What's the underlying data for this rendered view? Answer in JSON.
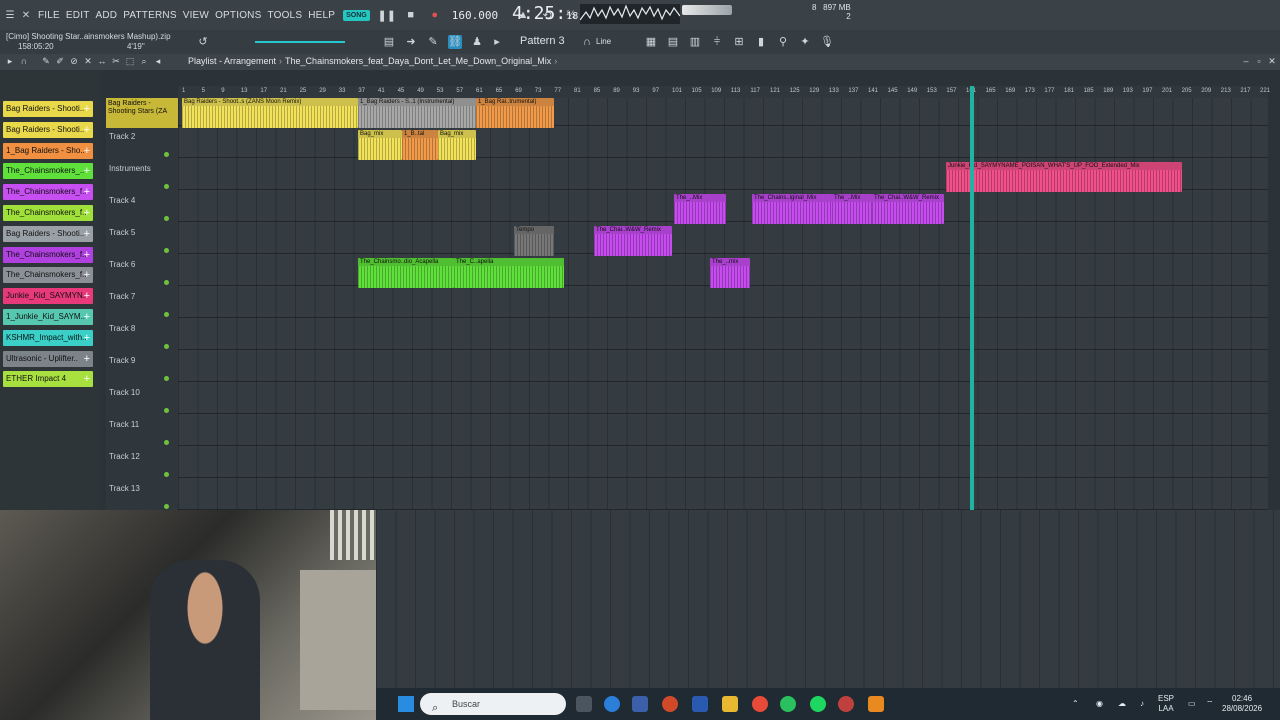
{
  "menu": [
    "FILE",
    "EDIT",
    "ADD",
    "PATTERNS",
    "VIEW",
    "OPTIONS",
    "TOOLS",
    "HELP"
  ],
  "transport": {
    "song_label": "SONG",
    "tempo": "160.000",
    "clock": "4:25",
    "clock_sub": "18",
    "memory": "897 MB",
    "mem_line2": "2",
    "cpu_num": "8"
  },
  "project": {
    "name": "[Cimo] Shooting Star..ainsmokers Mashup).zip",
    "time": "158:05:20",
    "length": "4'19\""
  },
  "toolbar2": {
    "pattern": "Pattern 3",
    "snap": "Line"
  },
  "playlist": {
    "title": "Playlist - Arrangement",
    "clip_name": "The_Chainsmokers_feat_Daya_Dont_Let_Me_Down_Original_Mix"
  },
  "picker": [
    {
      "label": "Bag Raiders - Shooti..",
      "color": "#e8d84a"
    },
    {
      "label": "Bag Raiders - Shooti..",
      "color": "#e8d84a"
    },
    {
      "label": "1_Bag Raiders - Sho..",
      "color": "#f09040"
    },
    {
      "label": "The_Chainsmokers_..",
      "color": "#5fe03a"
    },
    {
      "label": "The_Chainsmokers_f..",
      "color": "#c74ef0"
    },
    {
      "label": "The_Chainsmokers_f..",
      "color": "#9fe03a"
    },
    {
      "label": "Bag Raiders - Shooti..",
      "color": "#9aa1a6"
    },
    {
      "label": "The_Chainsmokers_f..",
      "color": "#b040e0"
    },
    {
      "label": "The_Chainsmokers_f..",
      "color": "#8a9096"
    },
    {
      "label": "Junkie_Kid_SAYMYN..",
      "color": "#e83a7a"
    },
    {
      "label": "1_Junkie_Kid_SAYM..",
      "color": "#57c8b0"
    },
    {
      "label": "KSHMR_Impact_with..",
      "color": "#3ad0c8"
    },
    {
      "label": "Ultrasonic - Uplifter..",
      "color": "#7c848a"
    },
    {
      "label": "ETHER Impact 4",
      "color": "#a8e040"
    }
  ],
  "tracks": [
    "Track 2",
    "Instruments",
    "Track 4",
    "Track 5",
    "Track 6",
    "Track 7",
    "Track 8",
    "Track 9",
    "Track 10",
    "Track 11",
    "Track 12",
    "Track 13"
  ],
  "track1_label": "Bag Raiders - Shooting Stars (ZA",
  "ruler": [
    "1",
    "5",
    "9",
    "13",
    "17",
    "21",
    "25",
    "29",
    "33",
    "37",
    "41",
    "45",
    "49",
    "53",
    "57",
    "61",
    "65",
    "69",
    "73",
    "77",
    "81",
    "85",
    "89",
    "93",
    "97",
    "101",
    "105",
    "109",
    "113",
    "117",
    "121",
    "125",
    "129",
    "133",
    "137",
    "141",
    "145",
    "149",
    "153",
    "157",
    "161",
    "165",
    "169",
    "173",
    "177",
    "181",
    "185",
    "189",
    "193",
    "197",
    "201",
    "205",
    "209",
    "213",
    "217",
    "221"
  ],
  "clips": {
    "c1": "Bag Raiders - Shoot..s (ZANS Moon Remix)",
    "c2": "Bag_mix",
    "c3": "1_Bag Raiders - S..1 (Instrumental)",
    "c4": "1_Bag Rai..trumental)",
    "c5": "Bag_mix",
    "c6": "1_B..tal",
    "c7": "Bag_mix",
    "c8": "Junkie_Kid_SAYMYNAME_POISAN_WHAT'S_UP_FOO_Extended_Mix",
    "c9": "The_..Mix",
    "c10": "The_Chains..iginal_Mix",
    "c11": "The_..Mix",
    "c12": "The_Chai..W&W_Remix",
    "c13": "The_Chai..W&W_Remix",
    "c14": "The_Chainsmo..dio_Acapella",
    "c15": "The_C..apella",
    "c16": "The_..mix",
    "c17": "Tempo"
  },
  "taskbar": {
    "search": "Buscar",
    "lang1": "ESP",
    "lang2": "LAA",
    "time": "02:46",
    "date": "28/08/2026"
  }
}
